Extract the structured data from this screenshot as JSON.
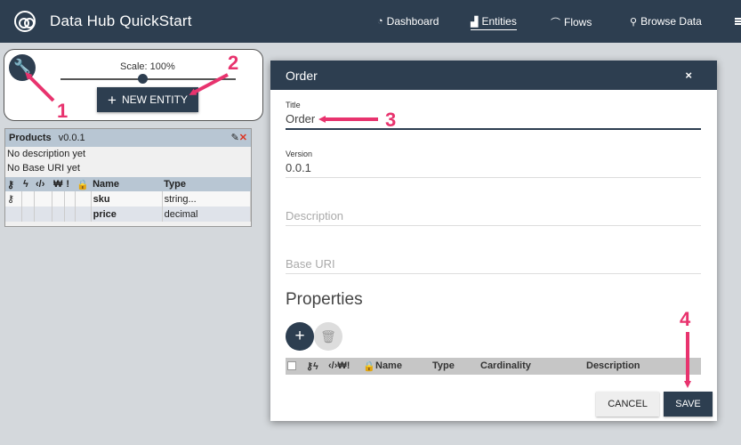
{
  "header": {
    "title": "Data Hub QuickStart",
    "nav": [
      {
        "label": "Dashboard",
        "icon": "dashboard-icon"
      },
      {
        "label": "Entities",
        "icon": "chart-icon"
      },
      {
        "label": "Flows",
        "icon": "flows-icon"
      },
      {
        "label": "Browse Data",
        "icon": "search-icon"
      }
    ]
  },
  "toolbar": {
    "scale_label": "Scale: 100%",
    "scale_value": 1.0,
    "new_entity_label": "NEW ENTITY"
  },
  "entity_card": {
    "name": "Products",
    "version": "v0.0.1",
    "description": "No description yet",
    "base_uri": "No Base URI yet",
    "columns": [
      "Name",
      "Type"
    ],
    "rows": [
      {
        "name": "sku",
        "type": "string..."
      },
      {
        "name": "price",
        "type": "decimal"
      }
    ]
  },
  "modal": {
    "title": "Order",
    "close": "×",
    "title_label": "Title",
    "title_value": "Order",
    "version_label": "Version",
    "version_value": "0.0.1",
    "description_placeholder": "Description",
    "base_uri_placeholder": "Base URI",
    "properties_title": "Properties",
    "props_columns": [
      "Name",
      "Type",
      "Cardinality",
      "Description"
    ],
    "cancel_label": "CANCEL",
    "save_label": "SAVE"
  },
  "annotations": [
    "1",
    "2",
    "3",
    "4"
  ],
  "colors": {
    "primary": "#2d3e50",
    "annotation": "#e8336e",
    "background": "#d4d8dc"
  }
}
